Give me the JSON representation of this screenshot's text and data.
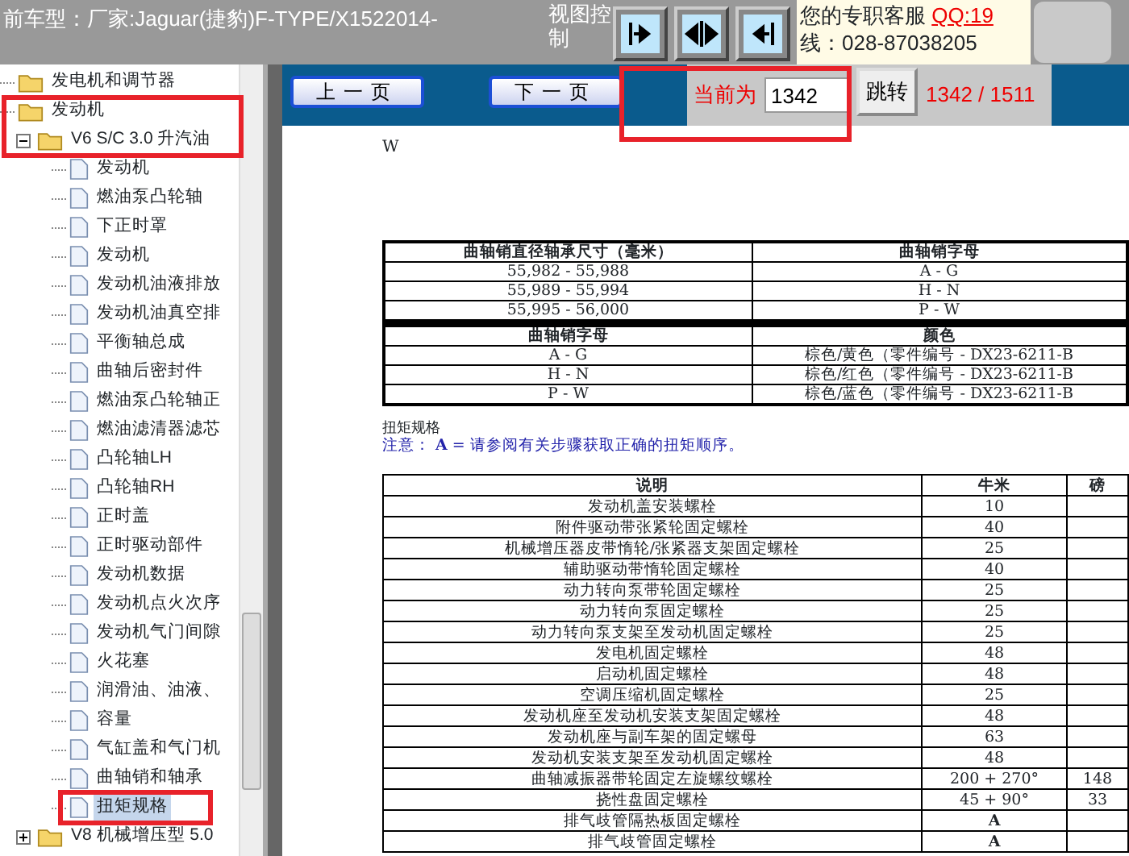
{
  "header": {
    "title": "前车型：厂家:Jaguar(捷豹)F-TYPE/X1522014-",
    "view_control_label": "视图控制",
    "support_label": "您的专职客服",
    "support_qq": "QQ:19",
    "support_phone": "线：028-87038205"
  },
  "tree": [
    {
      "label": "发电机和调节器",
      "kind": "folder",
      "selected": false
    },
    {
      "label": "发动机",
      "kind": "folder",
      "selected": false,
      "children": [
        {
          "label": "V6 S/C 3.0 升汽油",
          "kind": "folder",
          "selected": false,
          "expanded": true,
          "children": [
            {
              "label": "发动机",
              "kind": "doc",
              "selected": false
            },
            {
              "label": "燃油泵凸轮轴",
              "kind": "doc",
              "selected": false
            },
            {
              "label": "下正时罩",
              "kind": "doc",
              "selected": false
            },
            {
              "label": "发动机",
              "kind": "doc",
              "selected": false
            },
            {
              "label": "发动机油液排放",
              "kind": "doc",
              "selected": false
            },
            {
              "label": "发动机油真空排",
              "kind": "doc",
              "selected": false
            },
            {
              "label": "平衡轴总成",
              "kind": "doc",
              "selected": false
            },
            {
              "label": "曲轴后密封件",
              "kind": "doc",
              "selected": false
            },
            {
              "label": "燃油泵凸轮轴正",
              "kind": "doc",
              "selected": false
            },
            {
              "label": "燃油滤清器滤芯",
              "kind": "doc",
              "selected": false
            },
            {
              "label": "凸轮轴LH",
              "kind": "doc",
              "selected": false
            },
            {
              "label": "凸轮轴RH",
              "kind": "doc",
              "selected": false
            },
            {
              "label": "正时盖",
              "kind": "doc",
              "selected": false
            },
            {
              "label": "正时驱动部件",
              "kind": "doc",
              "selected": false
            },
            {
              "label": "发动机数据",
              "kind": "doc",
              "selected": false
            },
            {
              "label": "发动机点火次序",
              "kind": "doc",
              "selected": false
            },
            {
              "label": "发动机气门间隙",
              "kind": "doc",
              "selected": false
            },
            {
              "label": "火花塞",
              "kind": "doc",
              "selected": false
            },
            {
              "label": "润滑油、油液、",
              "kind": "doc",
              "selected": false
            },
            {
              "label": "容量",
              "kind": "doc",
              "selected": false
            },
            {
              "label": "气缸盖和气门机",
              "kind": "doc",
              "selected": false
            },
            {
              "label": "曲轴销和轴承",
              "kind": "doc",
              "selected": false
            },
            {
              "label": "扭矩规格",
              "kind": "doc",
              "selected": true
            }
          ]
        },
        {
          "label": "V8 机械增压型 5.0",
          "kind": "folder",
          "selected": false,
          "expanded": false
        }
      ]
    }
  ],
  "pager": {
    "prev": "上一页",
    "next": "下一页",
    "current_label": "当前为",
    "page_value": "1342",
    "go": "跳转",
    "page_count": "1342 / 1511"
  },
  "document": {
    "heading": "W",
    "tables": [
      {
        "columns": [
          "曲轴销直径轴承尺寸（毫米）",
          "曲轴销字母"
        ],
        "rows": [
          [
            "55,982 - 55,988",
            "A - G"
          ],
          [
            "55,989 - 55,994",
            "H - N"
          ],
          [
            "55,995 - 56,000",
            "P - W"
          ]
        ]
      },
      {
        "columns": [
          "曲轴销字母",
          "颜色"
        ],
        "rows": [
          [
            "A - G",
            "棕色/黄色（零件编号 - DX23-6211-B"
          ],
          [
            "H - N",
            "棕色/红色（零件编号 - DX23-6211-B"
          ],
          [
            "P - W",
            "棕色/蓝色（零件编号 - DX23-6211-B"
          ]
        ]
      }
    ],
    "section_title": "扭矩规格",
    "note_label": "注意：",
    "note_text": "**A** = 请参阅有关步骤获取正确的扭矩顺序。",
    "torque_table": {
      "columns": [
        "说明",
        "牛米",
        "磅"
      ],
      "rows": [
        {
          "cells": [
            "发动机盖安装螺栓",
            "10",
            ""
          ]
        },
        {
          "cells": [
            "附件驱动带张紧轮固定螺栓",
            "40",
            ""
          ]
        },
        {
          "cells": [
            "机械增压器皮带惰轮/张紧器支架固定螺栓",
            "25",
            ""
          ]
        },
        {
          "cells": [
            "辅助驱动带惰轮固定螺栓",
            "40",
            ""
          ]
        },
        {
          "cells": [
            "动力转向泵带轮固定螺栓",
            "25",
            ""
          ]
        },
        {
          "cells": [
            "动力转向泵固定螺栓",
            "25",
            ""
          ]
        },
        {
          "cells": [
            "动力转向泵支架至发动机固定螺栓",
            "25",
            ""
          ]
        },
        {
          "cells": [
            "发电机固定螺栓",
            "48",
            ""
          ]
        },
        {
          "cells": [
            "启动机固定螺栓",
            "48",
            ""
          ]
        },
        {
          "cells": [
            "空调压缩机固定螺栓",
            "25",
            ""
          ]
        },
        {
          "cells": [
            "发动机座至发动机安装支架固定螺栓",
            "48",
            ""
          ]
        },
        {
          "cells": [
            "发动机座与副车架的固定螺母",
            "63",
            ""
          ]
        },
        {
          "cells": [
            "发动机安装支架至发动机固定螺栓",
            "48",
            ""
          ]
        },
        {
          "cells": [
            "曲轴减振器带轮固定左旋螺纹螺栓",
            "200 + 270°",
            "148"
          ]
        },
        {
          "cells": [
            "挠性盘固定螺栓",
            "45 + 90°",
            "33"
          ]
        },
        {
          "cells": [
            "排气歧管隔热板固定螺栓",
            "A",
            ""
          ],
          "bold_value": true
        },
        {
          "cells": [
            "排气歧管固定螺栓",
            "A",
            ""
          ],
          "bold_value": true
        }
      ]
    }
  }
}
